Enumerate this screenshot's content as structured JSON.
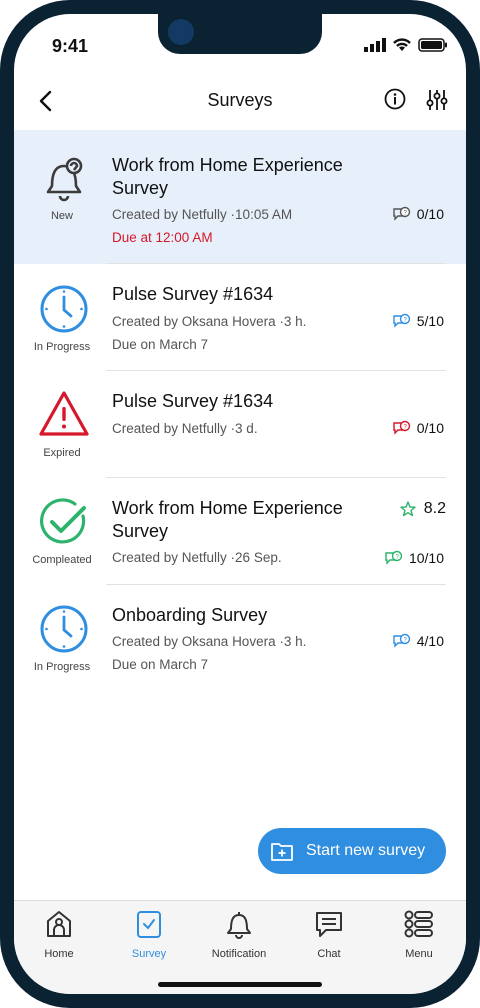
{
  "status_bar": {
    "time": "9:41"
  },
  "header": {
    "title": "Surveys"
  },
  "surveys": [
    {
      "status": "New",
      "title": "Work from Home Experience Survey",
      "meta": "Created by Netfully ·10:05 AM",
      "due": "Due at 12:00 AM",
      "count": "0/10",
      "rating": null
    },
    {
      "status": "In Progress",
      "title": "Pulse Survey #1634",
      "meta": "Created by Oksana Hovera ·3 h.",
      "due": "Due on March 7",
      "count": "5/10",
      "rating": null
    },
    {
      "status": "Expired",
      "title": "Pulse Survey #1634",
      "meta": "Created by Netfully ·3 d.",
      "due": "",
      "count": "0/10",
      "rating": null
    },
    {
      "status": "Compleated",
      "title": "Work from Home Experience Survey",
      "meta": "Created by Netfully ·26 Sep.",
      "due": "",
      "count": "10/10",
      "rating": "8.2"
    },
    {
      "status": "In Progress",
      "title": "Onboarding Survey",
      "meta": "Created by Oksana Hovera ·3 h.",
      "due": "Due on March 7",
      "count": "4/10",
      "rating": null
    }
  ],
  "fab": {
    "label": "Start new survey"
  },
  "tabs": [
    {
      "label": "Home"
    },
    {
      "label": "Survey"
    },
    {
      "label": "Notification"
    },
    {
      "label": "Chat"
    },
    {
      "label": "Menu"
    }
  ],
  "colors": {
    "accent": "#2f8ee0",
    "due_red": "#d5182a",
    "expired": "#d5182a",
    "complete": "#2db36b",
    "selected_bg": "#e7f0fa"
  }
}
